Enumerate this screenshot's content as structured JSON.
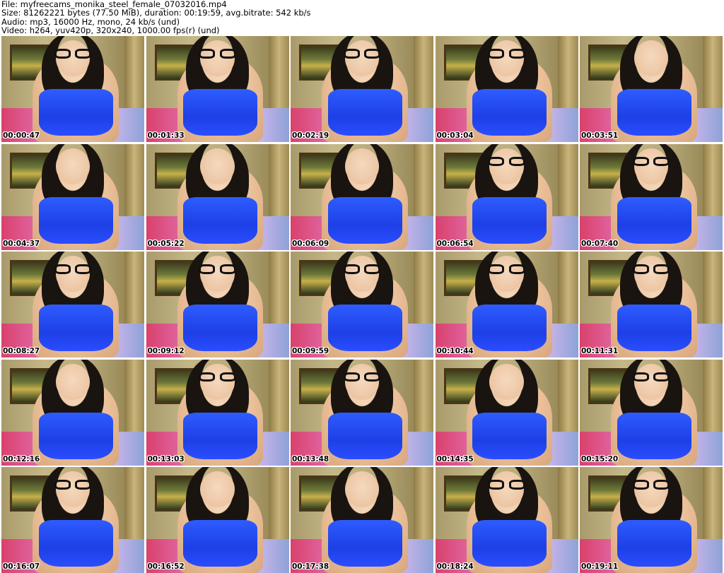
{
  "header": {
    "file_line": "File: myfreecams_monika_steel_female_07032016.mp4",
    "size_line": "Size: 81262221 bytes (77.50 MiB), duration: 00:19:59, avg.bitrate: 542 kb/s",
    "audio_line": "Audio: mp3, 16000 Hz, mono, 24 kb/s (und)",
    "video_line": "Video: h264, yuv420p, 320x240, 1000.00 fps(r) (und)"
  },
  "thumbnails": [
    {
      "timestamp": "00:00:47",
      "subject_icon": "glasses-face"
    },
    {
      "timestamp": "00:01:33",
      "subject_icon": "glasses-face"
    },
    {
      "timestamp": "00:02:19",
      "subject_icon": "glasses-face"
    },
    {
      "timestamp": "00:03:04",
      "subject_icon": "glasses-face"
    },
    {
      "timestamp": "00:03:51",
      "subject_icon": "torso"
    },
    {
      "timestamp": "00:04:37",
      "subject_icon": "torso"
    },
    {
      "timestamp": "00:05:22",
      "subject_icon": "torso"
    },
    {
      "timestamp": "00:06:09",
      "subject_icon": "torso"
    },
    {
      "timestamp": "00:06:54",
      "subject_icon": "glasses-face"
    },
    {
      "timestamp": "00:07:40",
      "subject_icon": "glasses-face"
    },
    {
      "timestamp": "00:08:27",
      "subject_icon": "glasses-face"
    },
    {
      "timestamp": "00:09:12",
      "subject_icon": "glasses-face"
    },
    {
      "timestamp": "00:09:59",
      "subject_icon": "glasses-face"
    },
    {
      "timestamp": "00:10:44",
      "subject_icon": "glasses-face"
    },
    {
      "timestamp": "00:11:31",
      "subject_icon": "glasses-face"
    },
    {
      "timestamp": "00:12:16",
      "subject_icon": "torso"
    },
    {
      "timestamp": "00:13:03",
      "subject_icon": "glasses-face"
    },
    {
      "timestamp": "00:13:48",
      "subject_icon": "glasses-face"
    },
    {
      "timestamp": "00:14:35",
      "subject_icon": "torso"
    },
    {
      "timestamp": "00:15:20",
      "subject_icon": "glasses-face"
    },
    {
      "timestamp": "00:16:07",
      "subject_icon": "glasses-face"
    },
    {
      "timestamp": "00:16:52",
      "subject_icon": "torso"
    },
    {
      "timestamp": "00:17:38",
      "subject_icon": "torso"
    },
    {
      "timestamp": "00:18:24",
      "subject_icon": "glasses-face"
    },
    {
      "timestamp": "00:19:11",
      "subject_icon": "glasses-face"
    }
  ],
  "colors": {
    "page_background": "#ffffff",
    "top_blue": "#2244ff",
    "stamp_text": "#000000"
  }
}
